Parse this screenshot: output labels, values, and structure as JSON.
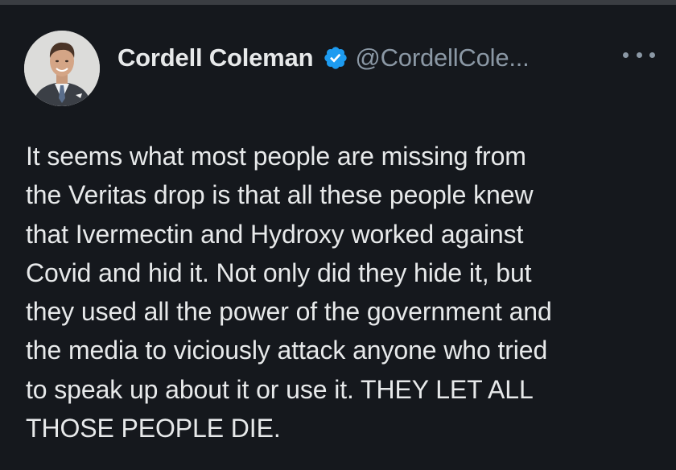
{
  "author": {
    "display_name": "Cordell Coleman",
    "handle": "@CordellCole...",
    "verified": true,
    "verified_color": "#1d9bf0",
    "avatar_icon": "profile-photo"
  },
  "menu": {
    "more_icon": "more-horizontal-icon"
  },
  "tweet": {
    "lines": [
      "It seems what most people are missing from",
      "the Veritas drop is that all these people knew",
      "that Ivermectin and Hydroxy worked against",
      "Covid and hid it. Not only did they hide it, but",
      "they used all the power of the government and",
      "the media to viciously attack anyone who tried",
      "to speak up about it or use it. THEY LET ALL",
      "THOSE PEOPLE DIE."
    ]
  },
  "colors": {
    "background": "#15181d",
    "text_primary": "#e7e9ea",
    "text_secondary": "#8b98a5"
  }
}
